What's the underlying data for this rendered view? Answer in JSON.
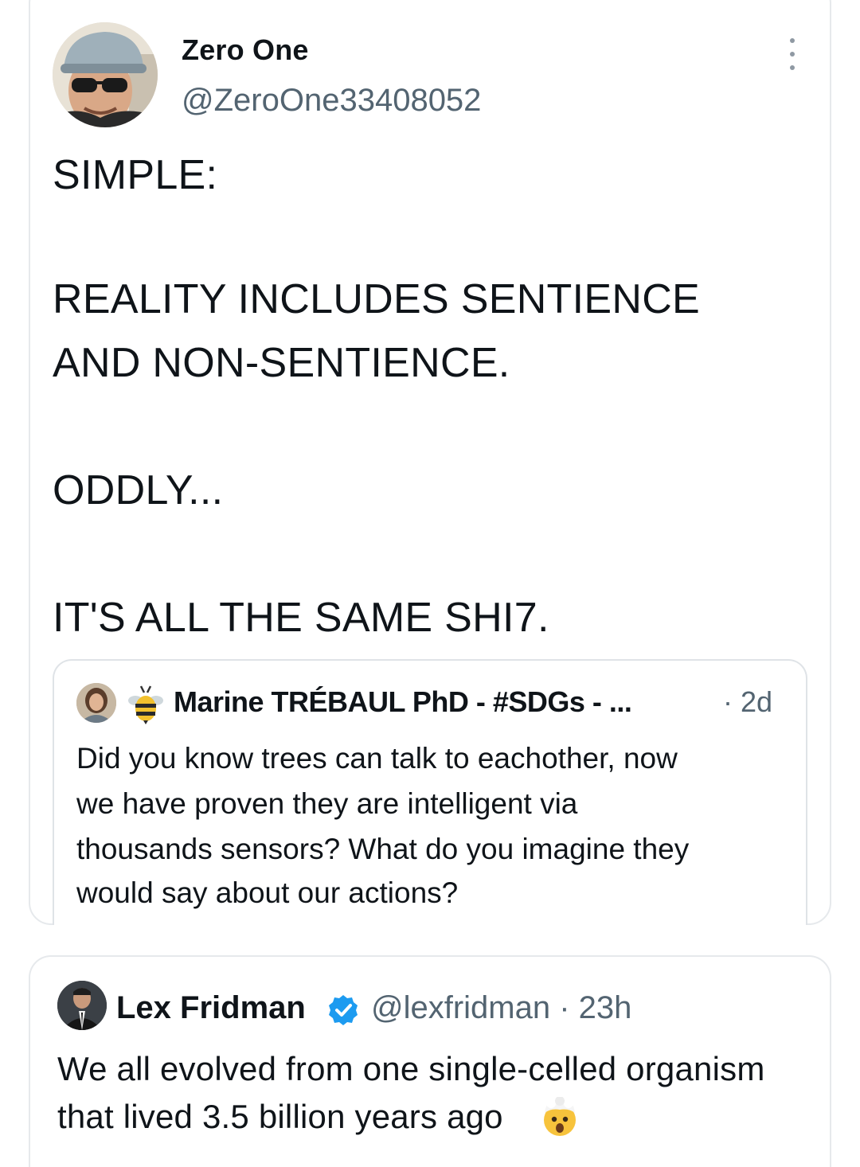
{
  "main_tweet": {
    "author_name": "Zero One",
    "author_handle": "@ZeroOne33408052",
    "lines": [
      "SIMPLE:",
      "REALITY INCLUDES SENTIENCE",
      "AND NON-SENTIENCE.",
      "ODDLY...",
      "IT'S ALL THE SAME SHI7."
    ]
  },
  "quoted_tweet": {
    "author_name": "Marine TRÉBAUL PhD - #SDGs - ...",
    "time": "· 2d",
    "lines": [
      "Did you know trees can talk to eachother, now",
      "we have proven they are intelligent via",
      "thousands sensors? What do you imagine they",
      "would say about our actions?"
    ]
  },
  "bottom_tweet": {
    "author_name": "Lex Fridman",
    "meta": "@lexfridman · 23h",
    "lines": [
      "We all evolved from one single-celled organism",
      "that lived 3.5 billion years ago"
    ]
  },
  "icons": {
    "more": "more-vertical-icon",
    "bee": "bee-emoji-icon",
    "verified": "verified-badge-icon",
    "mind_blown": "exploding-head-emoji-icon"
  },
  "colors": {
    "text": "#0f1419",
    "secondary": "#536471",
    "verified": "#1d9bf0",
    "border": "#e6e9ec"
  }
}
